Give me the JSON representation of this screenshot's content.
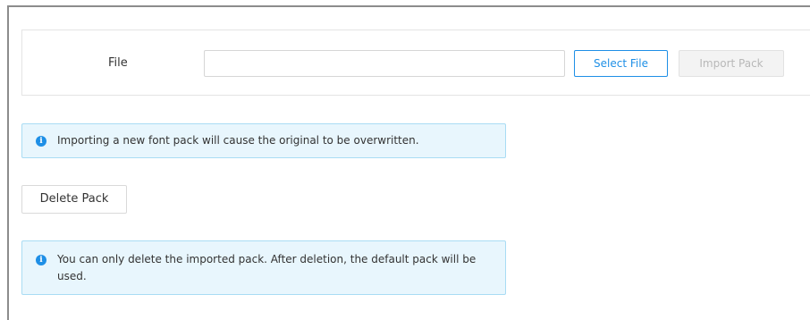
{
  "file_section": {
    "label": "File",
    "input_value": "",
    "input_placeholder": "",
    "select_file_label": "Select File",
    "import_pack_label": "Import Pack"
  },
  "notices": {
    "import_warning": "Importing a new font pack will cause the original to be overwritten.",
    "delete_info": "You can only delete the imported pack. After deletion, the default pack will be used."
  },
  "actions": {
    "delete_pack_label": "Delete Pack"
  },
  "icons": {
    "info_glyph": "i"
  },
  "colors": {
    "accent": "#1e8fe6",
    "info_bg": "#e8f6fd",
    "info_border": "#a9dcf4",
    "disabled_text": "#b8b8b8"
  }
}
